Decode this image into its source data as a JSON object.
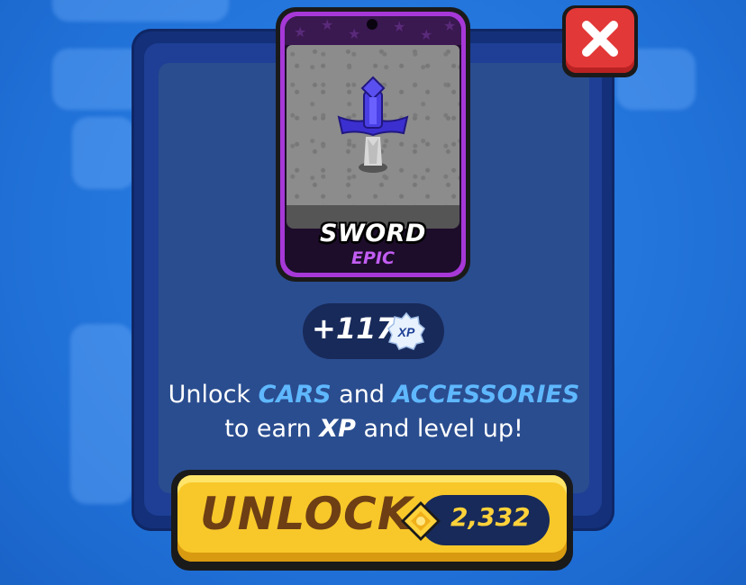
{
  "card": {
    "name": "SWORD",
    "rarity": "EPIC"
  },
  "xp": {
    "value": "+117",
    "badge": "XP"
  },
  "description": {
    "line1_prefix": "Unlock ",
    "cars": "CARS",
    "and": " and ",
    "accessories": "ACCESSORIES",
    "line2_prefix": "to earn ",
    "xp": "XP",
    "line2_suffix": " and level up!"
  },
  "unlock_button": {
    "label": "UNLOCK",
    "price": "2,332"
  },
  "colors": {
    "accent_blue": "#5fb8ff",
    "epic_purple": "#c25df2",
    "button_yellow": "#f8c82a",
    "close_red": "#e33838"
  },
  "icons": {
    "close": "close-icon",
    "xp": "xp-badge-icon",
    "currency": "coin-icon"
  }
}
